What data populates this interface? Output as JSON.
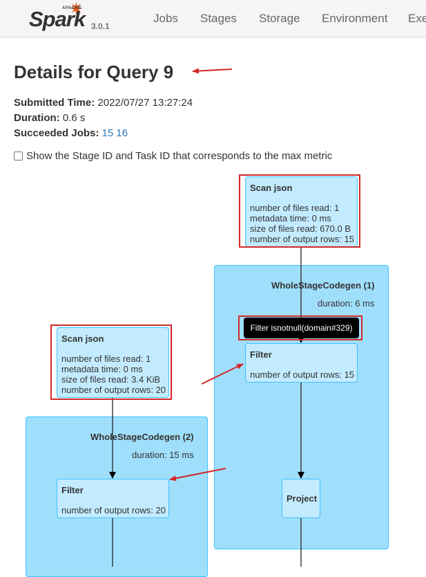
{
  "brand": {
    "apache": "APACHE",
    "name": "Spark",
    "version": "3.0.1"
  },
  "nav": [
    "Jobs",
    "Stages",
    "Storage",
    "Environment",
    "Exe"
  ],
  "page": {
    "title": "Details for Query 9"
  },
  "summary": {
    "submitted_label": "Submitted Time:",
    "submitted_value": "2022/07/27 13:27:24",
    "duration_label": "Duration:",
    "duration_value": "0.6 s",
    "jobs_label": "Succeeded Jobs:",
    "jobs": [
      "15",
      "16"
    ]
  },
  "checkbox": {
    "label": "Show the Stage ID and Task ID that corresponds to the max metric",
    "checked": false
  },
  "plan": {
    "scan1": {
      "name": "Scan json",
      "metrics": [
        "number of files read: 1",
        "metadata time: 0 ms",
        "size of files read: 670.0 B",
        "number of output rows: 15"
      ]
    },
    "wsc1": {
      "name": "WholeStageCodegen (1)",
      "duration": "duration: 6 ms"
    },
    "tooltip": "Filter isnotnull(domain#329)",
    "filter1": {
      "name": "Filter",
      "metrics": [
        "number of output rows: 15"
      ]
    },
    "scan2": {
      "name": "Scan json",
      "metrics": [
        "number of files read: 1",
        "metadata time: 0 ms",
        "size of files read: 3.4 KiB",
        "number of output rows: 20"
      ]
    },
    "wsc2": {
      "name": "WholeStageCodegen (2)",
      "duration": "duration: 15 ms"
    },
    "filter2": {
      "name": "Filter",
      "metrics": [
        "number of output rows: 20"
      ]
    },
    "project": {
      "name": "Project"
    }
  },
  "colors": {
    "annotation_red": "#d02828",
    "cluster_fill": "#a0dffc",
    "node_fill": "#c3ebff",
    "link": "#2879be",
    "spark_orange": "#e25a1c"
  }
}
